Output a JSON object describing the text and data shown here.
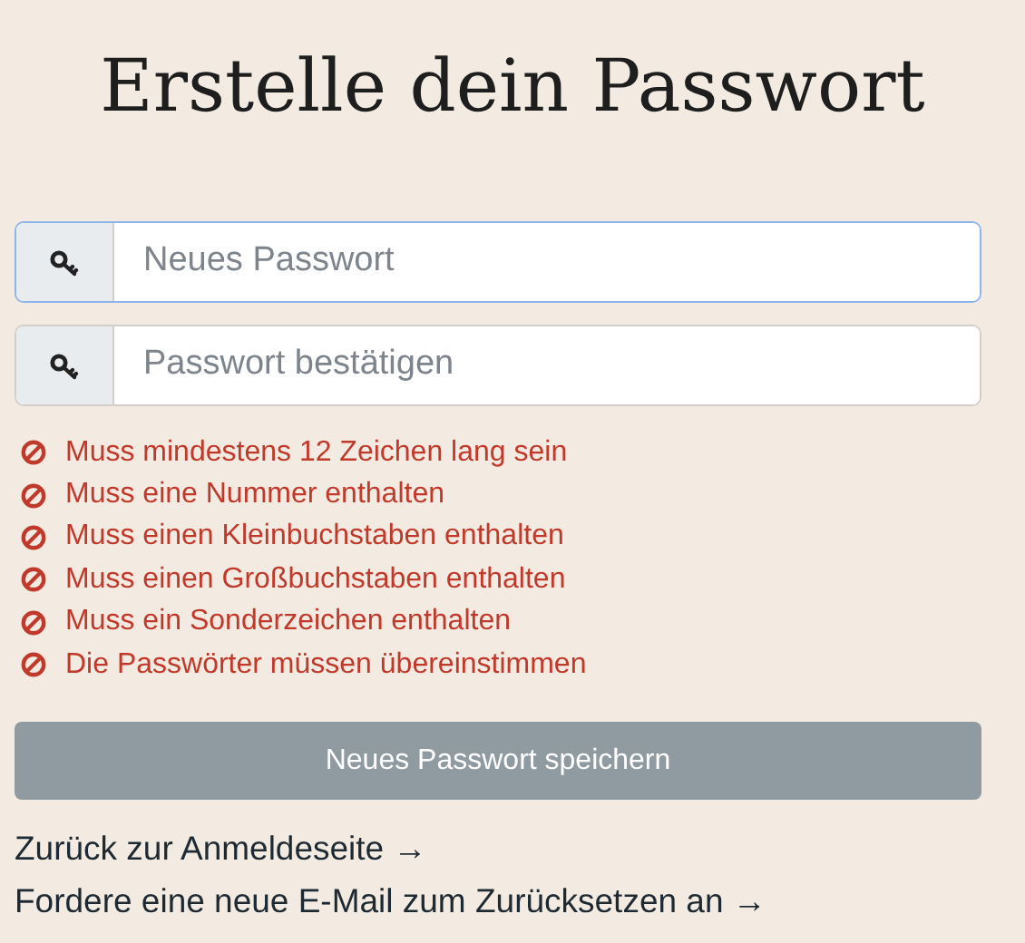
{
  "title": "Erstelle dein Passwort",
  "fields": [
    {
      "placeholder": "Neues Passwort",
      "focused": true
    },
    {
      "placeholder": "Passwort bestätigen",
      "focused": false
    }
  ],
  "rules": [
    {
      "text": "Muss mindestens 12 Zeichen lang sein",
      "met": false
    },
    {
      "text": "Muss eine Nummer enthalten",
      "met": false
    },
    {
      "text": "Muss einen Kleinbuchstaben enthalten",
      "met": false
    },
    {
      "text": "Muss einen Großbuchstaben enthalten",
      "met": false
    },
    {
      "text": "Muss ein Sonderzeichen enthalten",
      "met": false
    },
    {
      "text": "Die Passwörter müssen übereinstimmen",
      "met": false
    }
  ],
  "submit": {
    "label": "Neues Passwort speichern",
    "disabled": true
  },
  "links": [
    "Zurück zur Anmeldeseite →",
    "Fordere eine neue E-Mail zum Zurücksetzen an →"
  ]
}
